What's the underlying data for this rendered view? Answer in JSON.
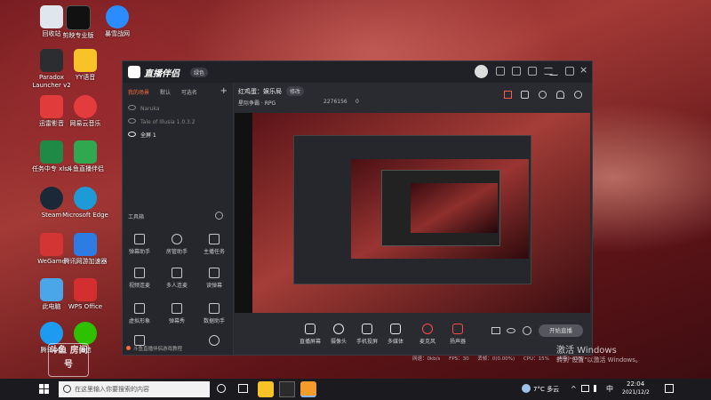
{
  "desktop_icons": [
    {
      "label": "回收站",
      "color": "#dfe6ee"
    },
    {
      "label": "剪映专业版",
      "color": "#111111"
    },
    {
      "label": "暴雪战网",
      "color": "#2a8cff"
    },
    {
      "label": "Paradox Launcher v2",
      "color": "#2c2d31"
    },
    {
      "label": "YY语音",
      "color": "#f7c326"
    },
    {
      "label": "迅雷影音",
      "color": "#e23b3b"
    },
    {
      "label": "网易云音乐",
      "color": "#e43c3c"
    },
    {
      "label": "任务中专 xlsx",
      "color": "#1e8a46"
    },
    {
      "label": "斗鱼直播伴侣",
      "color": "#2fa851"
    },
    {
      "label": "Steam",
      "color": "#1b2838"
    },
    {
      "label": "Microsoft Edge",
      "color": "#1e9bd7"
    },
    {
      "label": "WeGame",
      "color": "#d33434"
    },
    {
      "label": "腾讯网游加速器",
      "color": "#2d7ce3"
    },
    {
      "label": "此电脑",
      "color": "#4aa6e8"
    },
    {
      "label": "WPS Office",
      "color": "#d42e2e"
    },
    {
      "label": "腾讯QQ",
      "color": "#1d9bf0"
    },
    {
      "label": "微信",
      "color": "#2dc100"
    }
  ],
  "app": {
    "title": "直播伴侣",
    "badge": "绿色",
    "side_tabs": [
      "我的场景",
      "默认",
      "可选名"
    ],
    "scenes": [
      "Naruka",
      "Tale of Illusia 1.0.3.2",
      "全屏 1"
    ],
    "tools_label": "工具箱",
    "tools": [
      "弹幕助手",
      "房管助手",
      "主播任务",
      "视频连麦",
      "多人连麦",
      "读弹幕",
      "虚拟形象",
      "弹幕秀",
      "数据助手",
      "",
      "",
      ""
    ],
    "footer_text": "斗鱼直播伴侣游戏教程",
    "room_name": "红鸡蛋：娱乐局",
    "room_tag": "修改",
    "category": "星际争霸 · RPG",
    "viewers": "2276156",
    "likes": "0",
    "bottom_tools": [
      "直播屏幕",
      "摄像头",
      "手机投屏",
      "多媒体",
      "麦克风",
      "扬声器"
    ],
    "start_button": "开始直播",
    "stats": [
      "网速：0kb/s",
      "FPS：30",
      "丢帧：0(0.00%)",
      "CPU：15%",
      "内存：63%"
    ]
  },
  "activation": {
    "line1": "激活 Windows",
    "line2": "转到\"设置\"以激活 Windows。"
  },
  "watermark": "斗鱼 房间号",
  "taskbar": {
    "search_placeholder": "在这里输入你要搜索的内容",
    "weather": "7°C 多云",
    "time": "22:04",
    "date": "2021/12/2"
  }
}
